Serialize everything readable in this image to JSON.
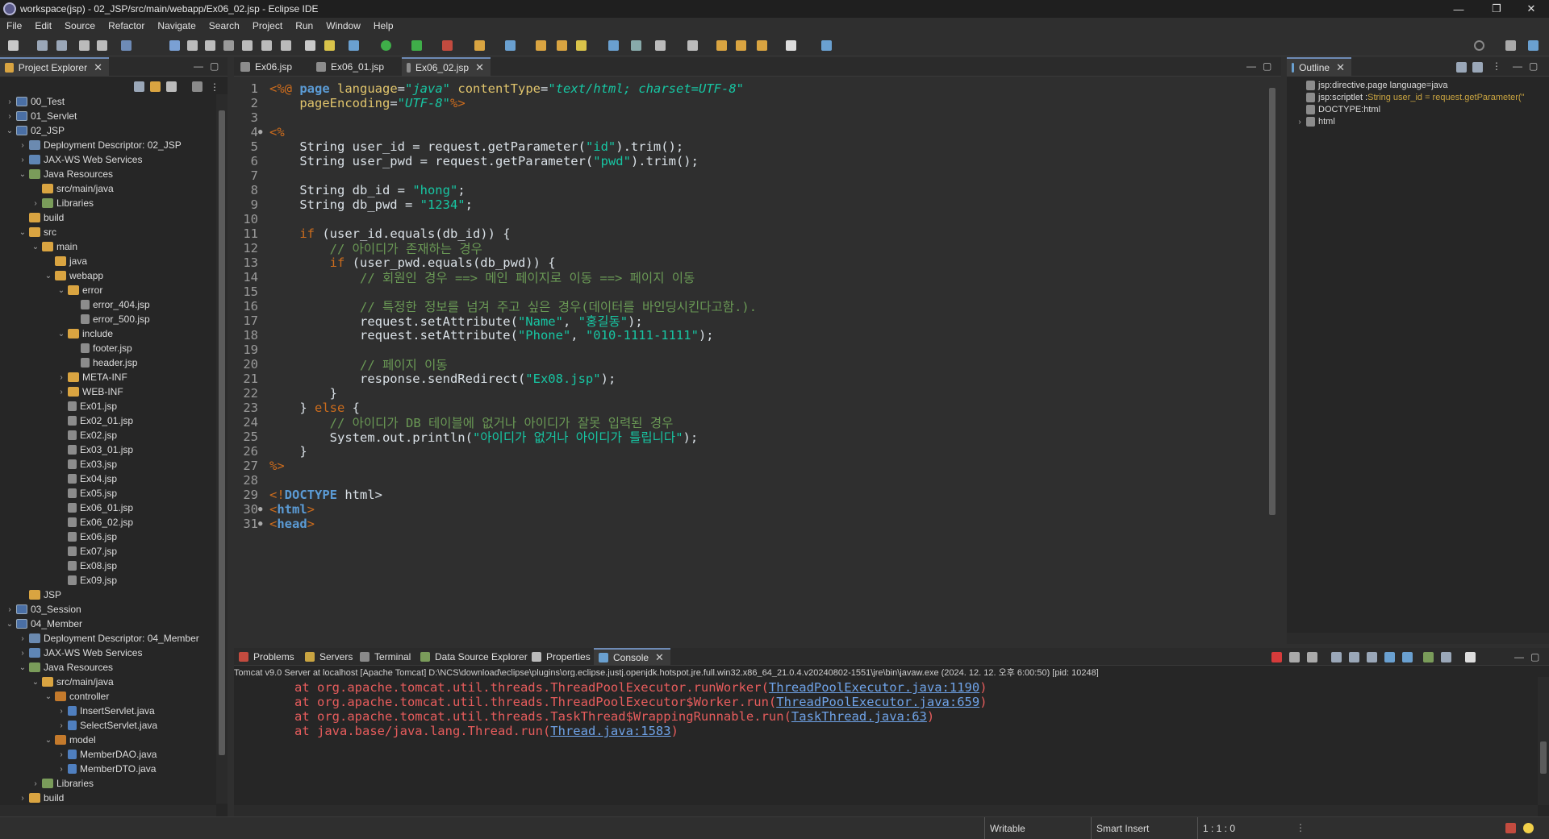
{
  "window": {
    "title": "workspace(jsp) - 02_JSP/src/main/webapp/Ex06_02.jsp - Eclipse IDE",
    "minimize": "—",
    "maximize": "❐",
    "close": "✕"
  },
  "menu": [
    "File",
    "Edit",
    "Source",
    "Refactor",
    "Navigate",
    "Search",
    "Project",
    "Run",
    "Window",
    "Help"
  ],
  "explorer": {
    "tab_label": "Project Explorer",
    "tree": [
      {
        "depth": 0,
        "arrow": "›",
        "icon": "proj",
        "label": "00_Test"
      },
      {
        "depth": 0,
        "arrow": "›",
        "icon": "proj",
        "label": "01_Servlet"
      },
      {
        "depth": 0,
        "arrow": "⌄",
        "icon": "proj",
        "label": "02_JSP"
      },
      {
        "depth": 1,
        "arrow": "›",
        "icon": "desc",
        "label": "Deployment Descriptor: 02_JSP"
      },
      {
        "depth": 1,
        "arrow": "›",
        "icon": "ws",
        "label": "JAX-WS Web Services"
      },
      {
        "depth": 1,
        "arrow": "⌄",
        "icon": "lib",
        "label": "Java Resources"
      },
      {
        "depth": 2,
        "arrow": "",
        "icon": "folder",
        "label": "src/main/java"
      },
      {
        "depth": 2,
        "arrow": "›",
        "icon": "lib",
        "label": "Libraries"
      },
      {
        "depth": 1,
        "arrow": "",
        "icon": "folder",
        "label": "build"
      },
      {
        "depth": 1,
        "arrow": "⌄",
        "icon": "folder",
        "label": "src"
      },
      {
        "depth": 2,
        "arrow": "⌄",
        "icon": "folder",
        "label": "main"
      },
      {
        "depth": 3,
        "arrow": "",
        "icon": "folder",
        "label": "java"
      },
      {
        "depth": 3,
        "arrow": "⌄",
        "icon": "folder",
        "label": "webapp"
      },
      {
        "depth": 4,
        "arrow": "⌄",
        "icon": "folder",
        "label": "error"
      },
      {
        "depth": 5,
        "arrow": "",
        "icon": "file",
        "label": "error_404.jsp"
      },
      {
        "depth": 5,
        "arrow": "",
        "icon": "file",
        "label": "error_500.jsp"
      },
      {
        "depth": 4,
        "arrow": "⌄",
        "icon": "folder",
        "label": "include"
      },
      {
        "depth": 5,
        "arrow": "",
        "icon": "file",
        "label": "footer.jsp"
      },
      {
        "depth": 5,
        "arrow": "",
        "icon": "file",
        "label": "header.jsp"
      },
      {
        "depth": 4,
        "arrow": "›",
        "icon": "folder",
        "label": "META-INF"
      },
      {
        "depth": 4,
        "arrow": "›",
        "icon": "folder",
        "label": "WEB-INF"
      },
      {
        "depth": 4,
        "arrow": "",
        "icon": "file",
        "label": "Ex01.jsp"
      },
      {
        "depth": 4,
        "arrow": "",
        "icon": "file",
        "label": "Ex02_01.jsp"
      },
      {
        "depth": 4,
        "arrow": "",
        "icon": "file",
        "label": "Ex02.jsp"
      },
      {
        "depth": 4,
        "arrow": "",
        "icon": "file",
        "label": "Ex03_01.jsp"
      },
      {
        "depth": 4,
        "arrow": "",
        "icon": "file",
        "label": "Ex03.jsp"
      },
      {
        "depth": 4,
        "arrow": "",
        "icon": "file",
        "label": "Ex04.jsp"
      },
      {
        "depth": 4,
        "arrow": "",
        "icon": "file",
        "label": "Ex05.jsp"
      },
      {
        "depth": 4,
        "arrow": "",
        "icon": "file",
        "label": "Ex06_01.jsp"
      },
      {
        "depth": 4,
        "arrow": "",
        "icon": "file",
        "label": "Ex06_02.jsp"
      },
      {
        "depth": 4,
        "arrow": "",
        "icon": "file",
        "label": "Ex06.jsp"
      },
      {
        "depth": 4,
        "arrow": "",
        "icon": "file",
        "label": "Ex07.jsp"
      },
      {
        "depth": 4,
        "arrow": "",
        "icon": "file",
        "label": "Ex08.jsp"
      },
      {
        "depth": 4,
        "arrow": "",
        "icon": "file",
        "label": "Ex09.jsp"
      },
      {
        "depth": 1,
        "arrow": "",
        "icon": "folder",
        "label": "JSP"
      },
      {
        "depth": 0,
        "arrow": "›",
        "icon": "proj",
        "label": "03_Session"
      },
      {
        "depth": 0,
        "arrow": "⌄",
        "icon": "proj",
        "label": "04_Member"
      },
      {
        "depth": 1,
        "arrow": "›",
        "icon": "desc",
        "label": "Deployment Descriptor: 04_Member"
      },
      {
        "depth": 1,
        "arrow": "›",
        "icon": "ws",
        "label": "JAX-WS Web Services"
      },
      {
        "depth": 1,
        "arrow": "⌄",
        "icon": "lib",
        "label": "Java Resources"
      },
      {
        "depth": 2,
        "arrow": "⌄",
        "icon": "folder",
        "label": "src/main/java"
      },
      {
        "depth": 3,
        "arrow": "⌄",
        "icon": "pkg",
        "label": "controller"
      },
      {
        "depth": 4,
        "arrow": "›",
        "icon": "java",
        "label": "InsertServlet.java"
      },
      {
        "depth": 4,
        "arrow": "›",
        "icon": "java",
        "label": "SelectServlet.java"
      },
      {
        "depth": 3,
        "arrow": "⌄",
        "icon": "pkg",
        "label": "model"
      },
      {
        "depth": 4,
        "arrow": "›",
        "icon": "java",
        "label": "MemberDAO.java"
      },
      {
        "depth": 4,
        "arrow": "›",
        "icon": "java",
        "label": "MemberDTO.java"
      },
      {
        "depth": 2,
        "arrow": "›",
        "icon": "lib",
        "label": "Libraries"
      },
      {
        "depth": 1,
        "arrow": "›",
        "icon": "folder",
        "label": "build"
      }
    ]
  },
  "editor": {
    "tabs": [
      {
        "label": "Ex06.jsp",
        "active": false
      },
      {
        "label": "Ex06_01.jsp",
        "active": false
      },
      {
        "label": "Ex06_02.jsp",
        "active": true
      }
    ],
    "lines": [
      {
        "n": "1",
        "fold": "",
        "html": "<span class='jsp'>&lt;%@</span> <span class='kwb'>page</span> <span class='attr'>language</span>=<span class='istr'>\"java\"</span> <span class='attr'>contentType</span>=<span class='istr'>\"text/html; charset=UTF-8\"</span>"
      },
      {
        "n": "2",
        "fold": "",
        "html": "    <span class='attr'>pageEncoding</span>=<span class='istr'>\"UTF-8\"</span><span class='jsp'>%&gt;</span>"
      },
      {
        "n": "3",
        "fold": "",
        "html": ""
      },
      {
        "n": "4",
        "fold": "●",
        "html": "<span class='jsp'>&lt;%</span>"
      },
      {
        "n": "5",
        "fold": "",
        "html": "    String user_id = request.getParameter(<span class='str'>\"id\"</span>).trim();"
      },
      {
        "n": "6",
        "fold": "",
        "html": "    String user_pwd = request.getParameter(<span class='str'>\"pwd\"</span>).trim();"
      },
      {
        "n": "7",
        "fold": "",
        "html": ""
      },
      {
        "n": "8",
        "fold": "",
        "html": "    String db_id = <span class='str'>\"hong\"</span>;"
      },
      {
        "n": "9",
        "fold": "",
        "html": "    String db_pwd = <span class='str'>\"1234\"</span>;"
      },
      {
        "n": "10",
        "fold": "",
        "html": ""
      },
      {
        "n": "11",
        "fold": "",
        "html": "    <span class='kw'>if</span> (user_id.equals(db_id)) {"
      },
      {
        "n": "12",
        "fold": "",
        "html": "        <span class='cm'>// 아이디가 존재하는 경우</span>"
      },
      {
        "n": "13",
        "fold": "",
        "html": "        <span class='kw'>if</span> (user_pwd.equals(db_pwd)) {"
      },
      {
        "n": "14",
        "fold": "",
        "html": "            <span class='cm'>// 회원인 경우 ==&gt; 메인 페이지로 이동 ==&gt; 페이지 이동</span>"
      },
      {
        "n": "15",
        "fold": "",
        "html": ""
      },
      {
        "n": "16",
        "fold": "",
        "html": "            <span class='cm'>// 특정한 정보를 넘겨 주고 싶은 경우(데이터를 바인딩시킨다고함.).</span>"
      },
      {
        "n": "17",
        "fold": "",
        "html": "            request.setAttribute(<span class='str'>\"Name\"</span>, <span class='str'>\"홍길동\"</span>);"
      },
      {
        "n": "18",
        "fold": "",
        "html": "            request.setAttribute(<span class='str'>\"Phone\"</span>, <span class='str'>\"010-1111-1111\"</span>);"
      },
      {
        "n": "19",
        "fold": "",
        "html": ""
      },
      {
        "n": "20",
        "fold": "",
        "html": "            <span class='cm'>// 페이지 이동</span>"
      },
      {
        "n": "21",
        "fold": "",
        "html": "            response.sendRedirect(<span class='str'>\"Ex08.jsp\"</span>);"
      },
      {
        "n": "22",
        "fold": "",
        "html": "        }"
      },
      {
        "n": "23",
        "fold": "",
        "html": "    } <span class='kw'>else</span> {"
      },
      {
        "n": "24",
        "fold": "",
        "html": "        <span class='cm'>// 아이디가 DB 테이블에 없거나 아이디가 잘못 입력된 경우</span>"
      },
      {
        "n": "25",
        "fold": "",
        "html": "        System.out.println(<span class='str'>\"아이디가 없거나 아이디가 틀립니다\"</span>);"
      },
      {
        "n": "26",
        "fold": "",
        "html": "    }"
      },
      {
        "n": "27",
        "fold": "",
        "html": "<span class='jsp'>%&gt;</span>"
      },
      {
        "n": "28",
        "fold": "",
        "html": ""
      },
      {
        "n": "29",
        "fold": "",
        "html": "<span class='tag'>&lt;!</span><span class='kwb'>DOCTYPE</span> html&gt;"
      },
      {
        "n": "30",
        "fold": "●",
        "html": "<span class='tag'>&lt;</span><span class='kwb'>html</span><span class='tag'>&gt;</span>"
      },
      {
        "n": "31",
        "fold": "●",
        "html": "<span class='tag'>&lt;</span><span class='kwb'>head</span><span class='tag'>&gt;</span>"
      }
    ]
  },
  "outline": {
    "tab_label": "Outline",
    "items": [
      {
        "label": "jsp:directive.page language=java",
        "extra": ""
      },
      {
        "label": "jsp:scriptlet : ",
        "extra": "String user_id = request.getParameter(\""
      },
      {
        "label": "DOCTYPE:html",
        "extra": ""
      },
      {
        "label": "html",
        "extra": ""
      }
    ]
  },
  "bottom": {
    "tabs": [
      "Problems",
      "Servers",
      "Terminal",
      "Data Source Explorer",
      "Properties",
      "Console"
    ],
    "active_tab": "Console",
    "console_header": "Tomcat v9.0 Server at localhost [Apache Tomcat] D:\\NCS\\download\\eclipse\\plugins\\org.eclipse.justj.openjdk.hotspot.jre.full.win32.x86_64_21.0.4.v20240802-1551\\jre\\bin\\javaw.exe  (2024. 12. 12. 오후 6:00:50) [pid: 10248]",
    "lines": [
      {
        "text": "at org.apache.tomcat.util.threads.ThreadPoolExecutor.runWorker(",
        "link": "ThreadPoolExecutor.java:1190",
        "tail": ")"
      },
      {
        "text": "at org.apache.tomcat.util.threads.ThreadPoolExecutor$Worker.run(",
        "link": "ThreadPoolExecutor.java:659",
        "tail": ")"
      },
      {
        "text": "at org.apache.tomcat.util.threads.TaskThread$WrappingRunnable.run(",
        "link": "TaskThread.java:63",
        "tail": ")"
      },
      {
        "text": "at java.base/java.lang.Thread.run(",
        "link": "Thread.java:1583",
        "tail": ")"
      }
    ]
  },
  "status": {
    "mode": "Writable",
    "insert": "Smart Insert",
    "position": "1 : 1 : 0"
  }
}
